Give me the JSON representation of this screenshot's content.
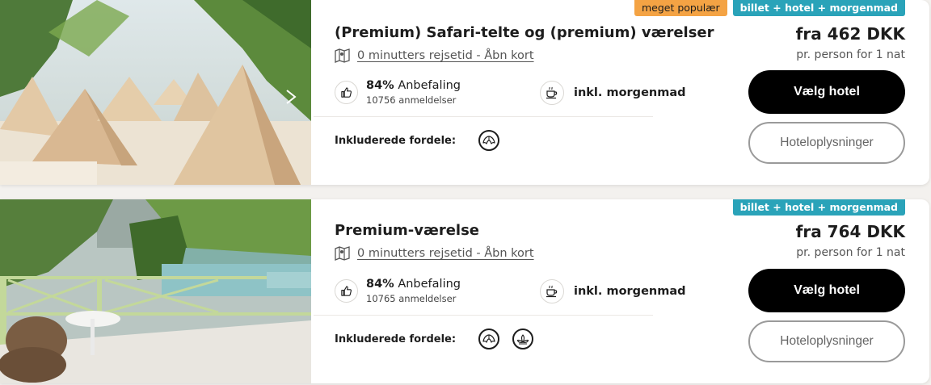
{
  "hotels": [
    {
      "tags": [
        "meget populær",
        "billet + hotel + morgenmad"
      ],
      "title": "(Premium) Safari-telte og (premium) værelser",
      "map_link": "0 minutters rejsetid - Åbn kort",
      "recommendation_percent": "84%",
      "recommendation_label": "Anbefaling",
      "reviews": "10756 anmeldelser",
      "breakfast": "inkl. morgenmad",
      "benefits_label": "Inkluderede fordele:",
      "price": "fra 462 DKK",
      "price_note": "pr. person for 1 nat",
      "select_button": "Vælg hotel",
      "info_button": "Hoteloplysninger"
    },
    {
      "tags": [
        "billet + hotel + morgenmad"
      ],
      "title": "Premium-værelse",
      "map_link": "0 minutters rejsetid - Åbn kort",
      "recommendation_percent": "84%",
      "recommendation_label": "Anbefaling",
      "reviews": "10765 anmeldelser",
      "breakfast": "inkl. morgenmad",
      "benefits_label": "Inkluderede fordele:",
      "price": "fra 764 DKK",
      "price_note": "pr. person for 1 nat",
      "select_button": "Vælg hotel",
      "info_button": "Hoteloplysninger"
    }
  ],
  "icons": {
    "map": "map-icon",
    "thumbs_up": "thumbs-up-icon",
    "coffee": "coffee-cup-icon",
    "croissant": "croissant-icon",
    "lotus": "lotus-icon",
    "next": "chevron-right-icon"
  },
  "colors": {
    "popular_tag": "#f4a344",
    "package_tag": "#2aa3b9",
    "primary_button": "#000000"
  }
}
